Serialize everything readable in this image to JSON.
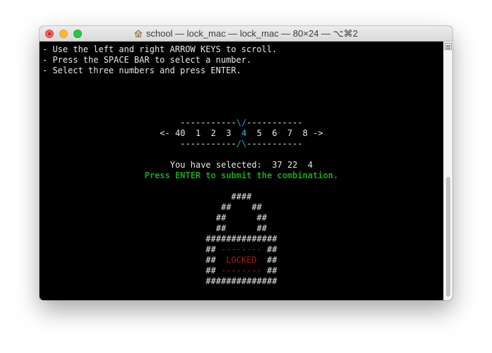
{
  "window": {
    "title": "school — lock_mac — lock_mac — 80×24 — ⌥⌘2",
    "icons": {
      "title": "home-folder-icon",
      "close": "close-button-icon",
      "minimize": "minimize-button-icon",
      "zoom": "zoom-button-icon"
    }
  },
  "terminal": {
    "instructions": [
      "- Use the left and right ARROW KEYS to scroll.",
      "- Press the SPACE BAR to select a number.",
      "- Select three numbers and press ENTER."
    ],
    "selector": {
      "top_left": "-----------",
      "top_marker": "\\/",
      "top_right": "-----------",
      "left_arrow": "<-",
      "numbers_before": "40  1  2  3",
      "current": "4",
      "numbers_after": "5  6  7  8",
      "right_arrow": "->",
      "bottom_left": "-----------",
      "bottom_marker": "/\\",
      "bottom_right": "-----------"
    },
    "selected_label": "You have selected:",
    "selected_values": "37 22  4",
    "prompt": "Press ENTER to submit the combination.",
    "lock": {
      "shackle": [
        "####",
        "##    ##",
        "##      ##",
        "##      ##"
      ],
      "body_top": "##############",
      "side": "##",
      "dashes": "--------",
      "status": "LOCKED",
      "body_bottom": "##############"
    }
  },
  "colors": {
    "terminal_bg": "#000000",
    "text": "#e8e8e8",
    "highlight": "#1c8fb0",
    "prompt_green": "#1aa31a",
    "locked_red": "#b01818"
  },
  "scrollbar": {
    "menu_icon": "split-pane-icon"
  }
}
